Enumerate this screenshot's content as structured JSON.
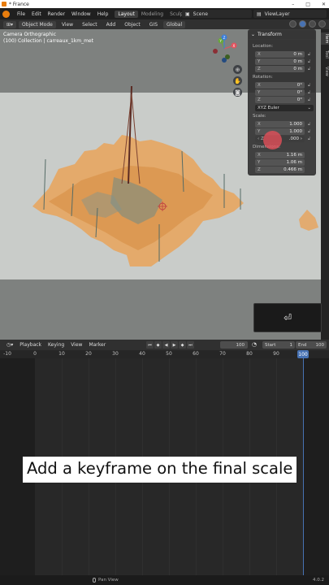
{
  "window": {
    "title": "* France",
    "buttons": [
      "–",
      "□",
      "✕"
    ]
  },
  "topbar": {
    "menus": [
      "File",
      "Edit",
      "Render",
      "Window",
      "Help"
    ],
    "workspaces": [
      "Layout",
      "Modeling",
      "Sculpting"
    ],
    "active_workspace": "Layout",
    "scene": "Scene",
    "view_layer": "ViewLayer"
  },
  "viewport_header": {
    "mode": "Object Mode",
    "menus": [
      "View",
      "Select",
      "Add",
      "Object",
      "GIS"
    ],
    "orientation": "Global"
  },
  "viewport": {
    "camera_label": "Camera Orthographic",
    "collection_label": "(100) Collection | carreaux_1km_met"
  },
  "gizmo": {
    "axes": [
      "X",
      "Y",
      "Z"
    ]
  },
  "transform_panel": {
    "title": "Transform",
    "location_label": "Location:",
    "location": [
      {
        "axis": "X",
        "value": "0 m"
      },
      {
        "axis": "Y",
        "value": "0 m"
      },
      {
        "axis": "Z",
        "value": "0 m"
      }
    ],
    "rotation_label": "Rotation:",
    "rotation": [
      {
        "axis": "X",
        "value": "0°"
      },
      {
        "axis": "Y",
        "value": "0°"
      },
      {
        "axis": "Z",
        "value": "0°"
      }
    ],
    "rotation_mode": "XYZ Euler",
    "scale_label": "Scale:",
    "scale": [
      {
        "axis": "X",
        "value": "1.000"
      },
      {
        "axis": "Y",
        "value": "1.000"
      },
      {
        "axis": "Z",
        "value": ".000"
      }
    ],
    "dimensions_label": "Dimensions:",
    "dimensions": [
      {
        "axis": "X",
        "value": "1.16 m"
      },
      {
        "axis": "Y",
        "value": "1.06 m"
      },
      {
        "axis": "Z",
        "value": "0.466 m"
      }
    ]
  },
  "sidebar_tabs": [
    "Item",
    "Tool",
    "View"
  ],
  "enter_key_label": "⏎",
  "timeline": {
    "menus": [
      "Playback",
      "Keying",
      "View",
      "Marker"
    ],
    "current_frame": "100",
    "start_label": "Start",
    "start_value": "1",
    "end_label": "End",
    "end_value": "100",
    "ruler_ticks": [
      "-10",
      "0",
      "10",
      "20",
      "30",
      "40",
      "50",
      "60",
      "70",
      "80",
      "90"
    ],
    "ruler_current": "100"
  },
  "caption": "Add a keyframe on the final scale",
  "statusbar": {
    "action": "Pan View",
    "version": "4.0.2"
  },
  "colors": {
    "accent": "#4772b3",
    "terrain": "#f0a050",
    "viewport_bg": "#c9ccc9"
  }
}
